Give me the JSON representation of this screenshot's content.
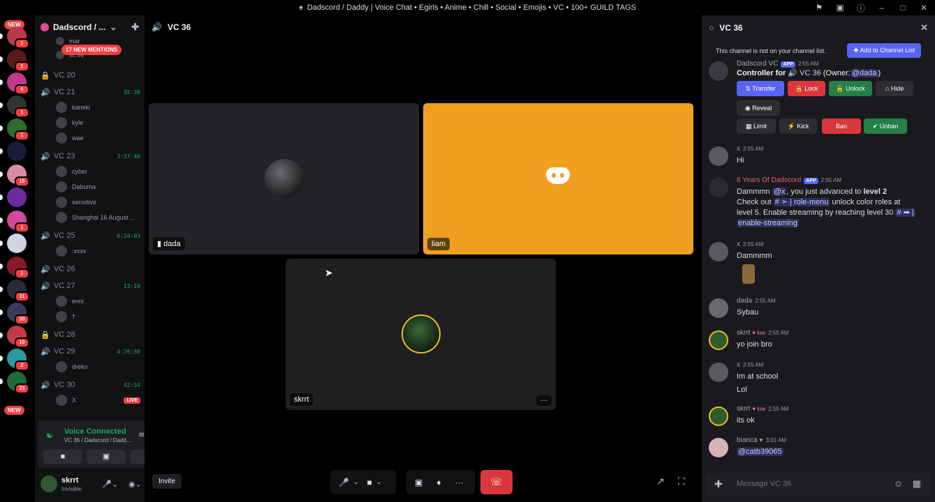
{
  "window": {
    "title": "Dadscord / Daddy | Voice Chat • Egirls • Anime • Chill • Social • Emojis • VC • 100+ GUILD TAGS"
  },
  "rail": {
    "new_top": "NEW",
    "new_bottom": "NEW",
    "servers": [
      {
        "badge": "1",
        "color": "#b83a4b"
      },
      {
        "badge": "1",
        "color": "#5a1a1a"
      },
      {
        "badge": "6",
        "color": "#c23a8a"
      },
      {
        "badge": "1",
        "color": "#333338"
      },
      {
        "badge": "1",
        "color": "#2f6b2f"
      },
      {
        "badge": "",
        "color": "#1a1a3a"
      },
      {
        "badge": "15",
        "color": "#d98aa6"
      },
      {
        "badge": "",
        "color": "#6a2aa0"
      },
      {
        "badge": "1",
        "color": "#d04aa0"
      },
      {
        "badge": "",
        "color": "#d0d4e0"
      },
      {
        "badge": "1",
        "color": "#8a1a2a"
      },
      {
        "badge": "11",
        "color": "#2a2a3a"
      },
      {
        "badge": "30",
        "color": "#3a3a5a"
      },
      {
        "badge": "10",
        "color": "#c23a4a"
      },
      {
        "badge": "2",
        "color": "#2a9aa0"
      },
      {
        "badge": "23",
        "color": "#1f6a3a"
      }
    ]
  },
  "sidebar": {
    "guild_name": "Dadscord / ...",
    "mentions": "17 NEW MENTIONS",
    "partial_users": [
      "mar",
      "st..ve"
    ],
    "channels": [
      {
        "name": "VC 20",
        "locked": true,
        "time": "",
        "live": "",
        "users": []
      },
      {
        "name": "VC 21",
        "locked": false,
        "time": "35:38",
        "live": "",
        "users": [
          "kaneki",
          "kyle",
          "wae"
        ]
      },
      {
        "name": "VC 23",
        "locked": false,
        "time": "3:37:40",
        "live": "",
        "users": [
          "cyber",
          "Dabuma",
          "sensitive",
          "Shanghai 16 August ..."
        ]
      },
      {
        "name": "VC 25",
        "locked": false,
        "time": "6:24:03",
        "live": "",
        "users": [
          ":xxxx"
        ]
      },
      {
        "name": "VC 26",
        "locked": false,
        "time": "",
        "live": "",
        "users": []
      },
      {
        "name": "VC 27",
        "locked": false,
        "time": "13:19",
        "live": "",
        "users": [
          "enni",
          "†"
        ]
      },
      {
        "name": "VC 28",
        "locked": true,
        "time": "",
        "live": "",
        "users": []
      },
      {
        "name": "VC 29",
        "locked": false,
        "time": "4:26:38",
        "live": "",
        "users": [
          "dreko"
        ]
      },
      {
        "name": "VC 30",
        "locked": false,
        "time": "42:34",
        "live": "LIVE",
        "users": [
          "X"
        ]
      }
    ]
  },
  "voice_panel": {
    "status": "Voice Connected",
    "subtitle": "VC 36 / Dadscord / Dadd..."
  },
  "user_panel": {
    "name": "skrrt",
    "status": "Invisible"
  },
  "stage": {
    "channel": "VC 36",
    "tiles": [
      {
        "name": "dada"
      },
      {
        "name": "liam"
      },
      {
        "name": "skrrt"
      }
    ],
    "invite_label": "Invite",
    "more_label": "···"
  },
  "chat": {
    "title": "VC 36",
    "notice": "This channel is not on your channel list.",
    "add_button": "Add to Channel List",
    "bot_author": "Dadscord VC",
    "bot_badge": "APP",
    "bot_time": "2:55 AM",
    "controller_line": {
      "prefix": "Controller for",
      "channel": "VC 36",
      "owner_pre": "(Owner:",
      "owner": "@dada",
      "owner_post": ")"
    },
    "control_buttons": [
      "Transfer",
      "Lock",
      "Unlock",
      "Hide",
      "Reveal",
      "Limit",
      "Kick",
      "Ban",
      "Unban"
    ],
    "messages": [
      {
        "author": "x",
        "time": "2:55 AM",
        "lines": [
          "Hi"
        ]
      },
      {
        "author": "8 Years Of Dadscord",
        "badge": "APP",
        "time": "2:55 AM",
        "lines": [
          "Dammmn",
          "@x",
          ", you just advanced to ",
          "level 2",
          "Check out",
          "# ➣ | role-menu",
          "unlock color roles at",
          "level 5. Enable streaming by reaching level 30",
          "# ➡ |",
          "enable-streaming"
        ]
      },
      {
        "author": "x",
        "time": "2:55 AM",
        "lines": [
          "Dammmm"
        ]
      },
      {
        "author": "dada",
        "time": "2:55 AM",
        "lines": [
          "Sybau"
        ]
      },
      {
        "author": "skrrt",
        "tag": "low",
        "time": "2:55 AM",
        "lines": [
          "yo join bro"
        ]
      },
      {
        "author": "x",
        "time": "2:55 AM",
        "lines": [
          "Im at school",
          "Lol"
        ]
      },
      {
        "author": "skrrt",
        "tag": "low",
        "time": "2:55 AM",
        "lines": [
          "its ok"
        ]
      },
      {
        "author": "bianca",
        "time": "3:01 AM",
        "lines": [
          "@catb39065"
        ]
      }
    ],
    "composer_placeholder": "Message VC 36"
  }
}
